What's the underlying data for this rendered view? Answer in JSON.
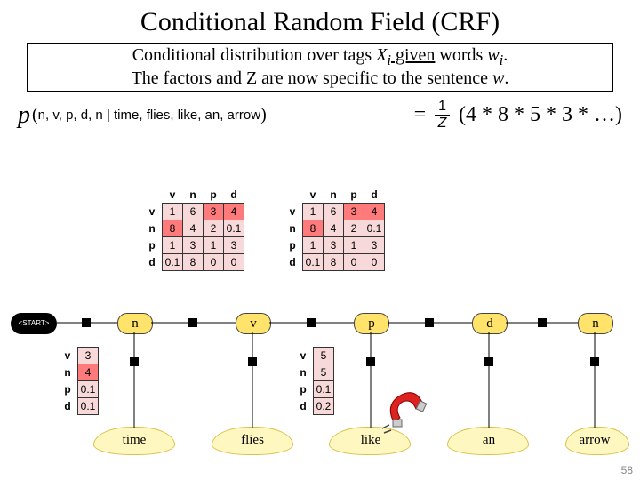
{
  "title": "Conditional Random Field (CRF)",
  "subtitle_line1_a": "Conditional distribution over tags ",
  "subtitle_line1_b": " given",
  "subtitle_line1_c": " words ",
  "subtitle_line1_d": ".",
  "subtitle_tag_var": "X",
  "subtitle_tag_sub": "i",
  "subtitle_word_var": "w",
  "subtitle_word_sub": "i",
  "subtitle_line2": "The factors and Z are now specific to the sentence ",
  "subtitle_line2_w": "w",
  "subtitle_line2_end": ".",
  "p_symbol": "p",
  "cond_left": "n, v, p, d, n",
  "cond_right": "time, flies, like, an, arrow",
  "equals": "=",
  "frac_num": "1",
  "frac_den": "Z",
  "product_expr": "(4 * 8 * 5 * 3 * …)",
  "tags": [
    "v",
    "n",
    "p",
    "d"
  ],
  "transition": {
    "rows": [
      {
        "tag": "v",
        "cells": [
          "1",
          "6",
          "3",
          "4"
        ],
        "hl": [
          2,
          3
        ]
      },
      {
        "tag": "n",
        "cells": [
          "8",
          "4",
          "2",
          "0.1"
        ],
        "hl": [
          0
        ]
      },
      {
        "tag": "p",
        "cells": [
          "1",
          "3",
          "1",
          "3"
        ],
        "hl": []
      },
      {
        "tag": "d",
        "cells": [
          "0.1",
          "8",
          "0",
          "0"
        ],
        "hl": []
      }
    ]
  },
  "emission": {
    "time": {
      "tag_vals": [
        [
          "v",
          "3"
        ],
        [
          "n",
          "4"
        ],
        [
          "p",
          "0.1"
        ],
        [
          "d",
          "0.1"
        ]
      ],
      "hl_row": 1
    },
    "like": {
      "tag_vals": [
        [
          "v",
          "5"
        ],
        [
          "n",
          "5"
        ],
        [
          "p",
          "0.1"
        ],
        [
          "d",
          "0.2"
        ]
      ],
      "hl_row": -1
    }
  },
  "nodes": {
    "start": "<START>",
    "n": "n",
    "v": "v",
    "p": "p",
    "d": "d"
  },
  "words": [
    "time",
    "flies",
    "like",
    "an",
    "arrow"
  ],
  "pagenum": "58"
}
